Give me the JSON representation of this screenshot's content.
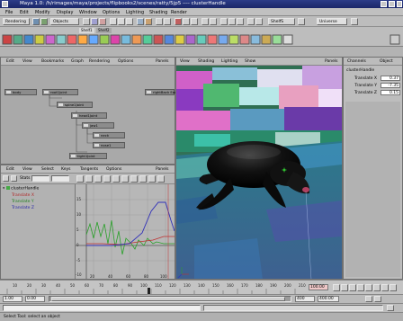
{
  "window": {
    "title": "Maya 1.0: /h/rimages/maya/projects/flipbooks2/scenes/ratty/5jp5   ----   clusterHandle"
  },
  "menubar": {
    "items": [
      "File",
      "Edit",
      "Modify",
      "Display",
      "Window",
      "Options",
      "Lighting",
      "Shading",
      "Render"
    ]
  },
  "toolbar": {
    "mode_dropdown": "Rendering",
    "objects_label": "Objects",
    "selection_label": "ShelfS",
    "universe_label": "Universe"
  },
  "shelf": {
    "tabs": [
      "Shelf1",
      "Shelf2"
    ],
    "active_tab": 0
  },
  "hypergraph": {
    "menu": [
      "Edit",
      "View",
      "Bookmarks",
      "Graph",
      "Rendering",
      "Options",
      "Panels"
    ],
    "nodes": [
      {
        "label": "body"
      },
      {
        "label": "root1Joint"
      },
      {
        "label": "rightBack Ear"
      },
      {
        "label": "spine1Joint"
      },
      {
        "label": "head1Joint"
      },
      {
        "label": "jaw1"
      },
      {
        "label": "neck"
      },
      {
        "label": "nose1"
      },
      {
        "label": "tight1Joint"
      }
    ]
  },
  "graph_editor": {
    "menu": [
      "Edit",
      "View",
      "Select",
      "Keys",
      "Tangents",
      "Options",
      "Panels"
    ],
    "stats_label": "Stats",
    "outliner_title": "clusterHandle",
    "outliner_items": [
      "Translate X",
      "Translate Y",
      "Translate Z"
    ],
    "y_ticks": [
      "15",
      "10",
      "5",
      "0",
      "-5",
      "-10"
    ],
    "x_ticks": [
      "20",
      "40",
      "60",
      "80",
      "100"
    ],
    "colors": {
      "x": "#c03030",
      "y": "#28a028",
      "z": "#3030b8"
    }
  },
  "viewport": {
    "menu": [
      "View",
      "Shading",
      "Lighting",
      "Show",
      "Panels"
    ]
  },
  "channel_box": {
    "tabs": [
      "Channels",
      "Object"
    ],
    "object_name": "clusterHandle",
    "channels": [
      {
        "label": "Translate X",
        "value": "0.37"
      },
      {
        "label": "Translate Y",
        "value": "-7.35"
      },
      {
        "label": "Translate Z",
        "value": "0.15"
      }
    ]
  },
  "timeline": {
    "ticks": [
      "10",
      "20",
      "30",
      "40",
      "50",
      "60",
      "70",
      "80",
      "90",
      "100",
      "110",
      "120",
      "130",
      "140",
      "150",
      "160",
      "170",
      "180",
      "190",
      "200",
      "210"
    ],
    "current_frame": "100.00"
  },
  "range": {
    "start": "1.00",
    "min": "0.00",
    "end": "400",
    "max": "400.00"
  },
  "help_line": "Select Tool: select an object"
}
